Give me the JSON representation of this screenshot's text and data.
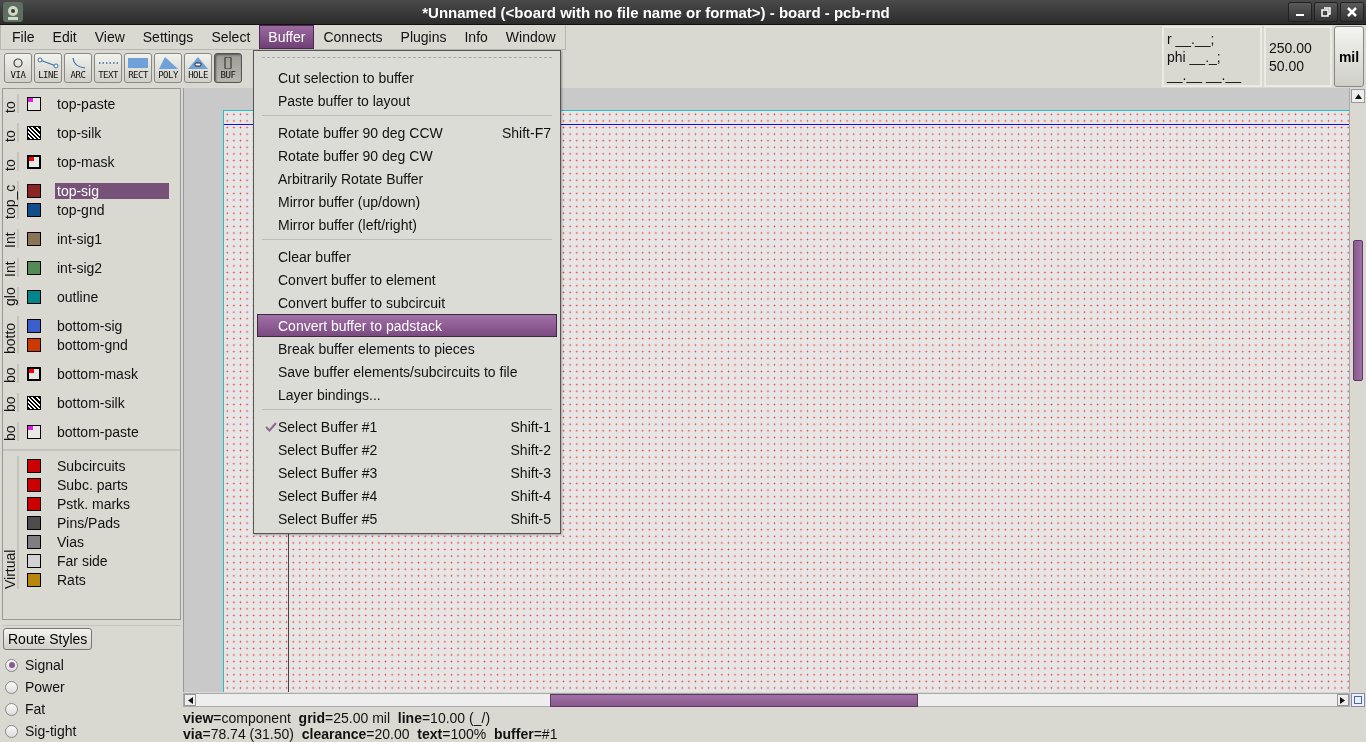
{
  "window": {
    "title": "*Unnamed (<board with no file name or format>) - board - pcb-rnd"
  },
  "menubar": [
    {
      "label": "File",
      "selected": false
    },
    {
      "label": "Edit",
      "selected": false
    },
    {
      "label": "View",
      "selected": false
    },
    {
      "label": "Settings",
      "selected": false
    },
    {
      "label": "Select",
      "selected": false
    },
    {
      "label": "Buffer",
      "selected": true
    },
    {
      "label": "Connects",
      "selected": false
    },
    {
      "label": "Plugins",
      "selected": false
    },
    {
      "label": "Info",
      "selected": false
    },
    {
      "label": "Window",
      "selected": false
    }
  ],
  "toolbar": [
    {
      "label": "VIA",
      "kind": "via",
      "selected": false
    },
    {
      "label": "LINE",
      "kind": "line",
      "selected": false
    },
    {
      "label": "ARC",
      "kind": "arc",
      "selected": false
    },
    {
      "label": "TEXT",
      "kind": "text",
      "selected": false
    },
    {
      "label": "RECT",
      "kind": "rect",
      "selected": false
    },
    {
      "label": "POLY",
      "kind": "poly",
      "selected": false
    },
    {
      "label": "HOLE",
      "kind": "hole",
      "selected": false
    },
    {
      "label": "BUF",
      "kind": "buf",
      "selected": true
    }
  ],
  "readout": {
    "coords": [
      "r __.__;",
      "phi __._;",
      "__.__ __.__"
    ],
    "values": [
      "250.00",
      "50.00"
    ],
    "unit_button": "mil"
  },
  "layer_groups": [
    {
      "label": "to",
      "items": [
        {
          "name": "top-paste",
          "kind": "paste",
          "color": "#e020e0",
          "selected": false
        }
      ]
    },
    {
      "label": "to",
      "items": [
        {
          "name": "top-silk",
          "kind": "hatch",
          "color": "#000000",
          "selected": false
        }
      ]
    },
    {
      "label": "to",
      "items": [
        {
          "name": "top-mask",
          "kind": "mask",
          "color": "#ff0000",
          "selected": false
        }
      ]
    },
    {
      "label": "top_c",
      "items": [
        {
          "name": "top-sig",
          "kind": "solid",
          "color": "#8b2323",
          "selected": true
        },
        {
          "name": "top-gnd",
          "kind": "solid",
          "color": "#104e8b",
          "selected": false
        }
      ]
    },
    {
      "label": "Int",
      "items": [
        {
          "name": "int-sig1",
          "kind": "solid",
          "color": "#8b7355",
          "selected": false
        }
      ]
    },
    {
      "label": "Int",
      "items": [
        {
          "name": "int-sig2",
          "kind": "solid",
          "color": "#548b54",
          "selected": false
        }
      ]
    },
    {
      "label": "glo",
      "items": [
        {
          "name": "outline",
          "kind": "solid",
          "color": "#00868b",
          "selected": false
        }
      ]
    },
    {
      "label": "botto",
      "items": [
        {
          "name": "bottom-sig",
          "kind": "solid",
          "color": "#3a5fcd",
          "selected": false
        },
        {
          "name": "bottom-gnd",
          "kind": "solid",
          "color": "#cd3700",
          "selected": false
        }
      ]
    },
    {
      "label": "bo",
      "items": [
        {
          "name": "bottom-mask",
          "kind": "mask",
          "color": "#ff0000",
          "selected": false
        }
      ]
    },
    {
      "label": "bo",
      "items": [
        {
          "name": "bottom-silk",
          "kind": "hatch",
          "color": "#000000",
          "selected": false
        }
      ]
    },
    {
      "label": "bo",
      "items": [
        {
          "name": "bottom-paste",
          "kind": "paste",
          "color": "#e020e0",
          "selected": false
        }
      ]
    }
  ],
  "virtual_group": {
    "label": "Virtual",
    "items": [
      {
        "name": "Subcircuits",
        "color": "#cc0000"
      },
      {
        "name": "Subc. parts",
        "color": "#cc0000"
      },
      {
        "name": "Pstk. marks",
        "color": "#cc0000"
      },
      {
        "name": "Pins/Pads",
        "color": "#4d4d4d"
      },
      {
        "name": "Vias",
        "color": "#7f7f7f"
      },
      {
        "name": "Far side",
        "color": "#d3d3d3"
      },
      {
        "name": "Rats",
        "color": "#b8860b"
      }
    ]
  },
  "route_styles": {
    "button": "Route Styles",
    "styles": [
      {
        "label": "Signal",
        "selected": true
      },
      {
        "label": "Power",
        "selected": false
      },
      {
        "label": "Fat",
        "selected": false
      },
      {
        "label": "Sig-tight",
        "selected": false
      }
    ]
  },
  "buffer_menu": {
    "sections": [
      [
        {
          "label": "Cut selection to buffer",
          "selected": false
        },
        {
          "label": "Paste buffer to layout",
          "selected": false
        }
      ],
      [
        {
          "label": "Rotate buffer 90 deg CCW",
          "shortcut": "Shift-F7",
          "selected": false
        },
        {
          "label": "Rotate buffer 90 deg CW",
          "selected": false
        },
        {
          "label": "Arbitrarily Rotate Buffer",
          "selected": false
        },
        {
          "label": "Mirror buffer (up/down)",
          "selected": false
        },
        {
          "label": "Mirror buffer (left/right)",
          "selected": false
        }
      ],
      [
        {
          "label": "Clear buffer",
          "selected": false
        },
        {
          "label": "Convert buffer to element",
          "selected": false
        },
        {
          "label": "Convert buffer to subcircuit",
          "selected": false
        },
        {
          "label": "Convert buffer to padstack",
          "selected": true
        },
        {
          "label": "Break buffer elements to pieces",
          "selected": false
        },
        {
          "label": "Save buffer elements/subcircuits to file",
          "selected": false
        },
        {
          "label": "Layer bindings...",
          "selected": false
        }
      ],
      [
        {
          "label": "Select Buffer #1",
          "shortcut": "Shift-1",
          "checked": true,
          "selected": false
        },
        {
          "label": "Select Buffer #2",
          "shortcut": "Shift-2",
          "checked": false,
          "selected": false
        },
        {
          "label": "Select Buffer #3",
          "shortcut": "Shift-3",
          "checked": false,
          "selected": false
        },
        {
          "label": "Select Buffer #4",
          "shortcut": "Shift-4",
          "checked": false,
          "selected": false
        },
        {
          "label": "Select Buffer #5",
          "shortcut": "Shift-5",
          "checked": false,
          "selected": false
        }
      ]
    ]
  },
  "status_bar": {
    "lines": [
      "**view**=component  **grid**=25.00 mil  **line**=10.00 (_/)",
      "**via**=78.74 (31.50)  **clearance**=20.00  **text**=100%  **buffer**=#1"
    ]
  }
}
